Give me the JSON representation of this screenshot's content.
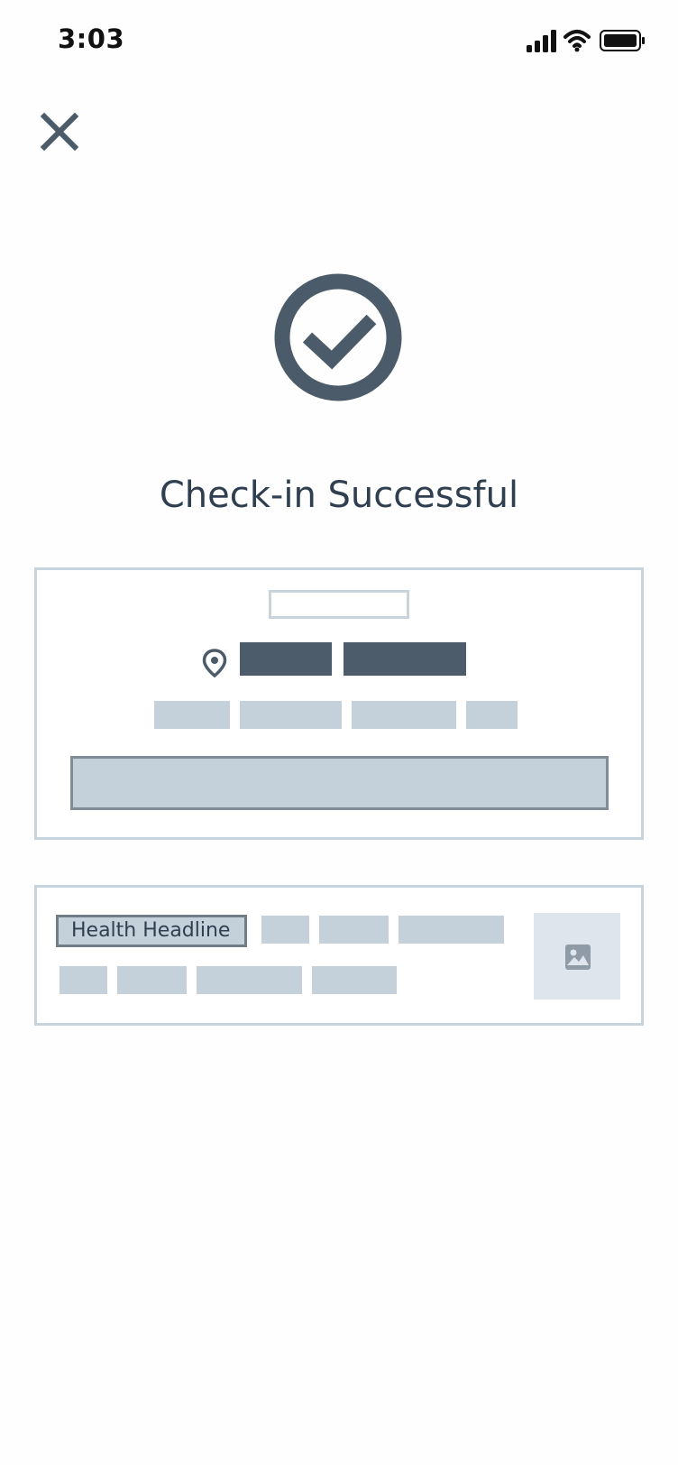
{
  "status_bar": {
    "time": "3:03",
    "icons": [
      "cellular-signal-icon",
      "wifi-icon",
      "battery-icon"
    ]
  },
  "close_icon": "close-icon",
  "success_icon": "check-circle-icon",
  "title": "Check-in Successful",
  "card_location": {
    "icon": "map-pin-icon"
  },
  "card_health": {
    "headline": "Health Headline",
    "thumbnail_icon": "image-icon"
  },
  "colors": {
    "icon": "#4b5b69",
    "title": "#2f3f50",
    "placeholder_dark": "#4c5c6a",
    "placeholder_light": "#c4d0da",
    "border": "#c9d3dc"
  }
}
